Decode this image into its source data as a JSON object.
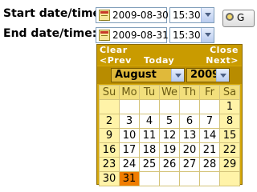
{
  "start": {
    "label": "Start date/time:",
    "date": "2009-08-30",
    "time": "15:30"
  },
  "end": {
    "label": "End date/time:",
    "date": "2009-08-31",
    "time": "15:30"
  },
  "go_button": {
    "label": "G"
  },
  "calendar": {
    "clear": "Clear",
    "close": "Close",
    "prev": "<Prev",
    "today": "Today",
    "next": "Next>",
    "month": "August",
    "year": "2009",
    "weekdays": [
      "Su",
      "Mo",
      "Tu",
      "We",
      "Th",
      "Fr",
      "Sa"
    ],
    "weeks": [
      [
        "",
        "",
        "",
        "",
        "",
        "",
        "1"
      ],
      [
        "2",
        "3",
        "4",
        "5",
        "6",
        "7",
        "8"
      ],
      [
        "9",
        "10",
        "11",
        "12",
        "13",
        "14",
        "15"
      ],
      [
        "16",
        "17",
        "18",
        "19",
        "20",
        "21",
        "22"
      ],
      [
        "23",
        "24",
        "25",
        "26",
        "27",
        "28",
        "29"
      ],
      [
        "30",
        "31",
        "",
        "",
        "",
        "",
        ""
      ]
    ],
    "highlighted_day": "31",
    "colors": {
      "header_bar": "#c99b00",
      "today_cell": "#f07d00",
      "weekend_cell": "#fff3a8"
    }
  }
}
